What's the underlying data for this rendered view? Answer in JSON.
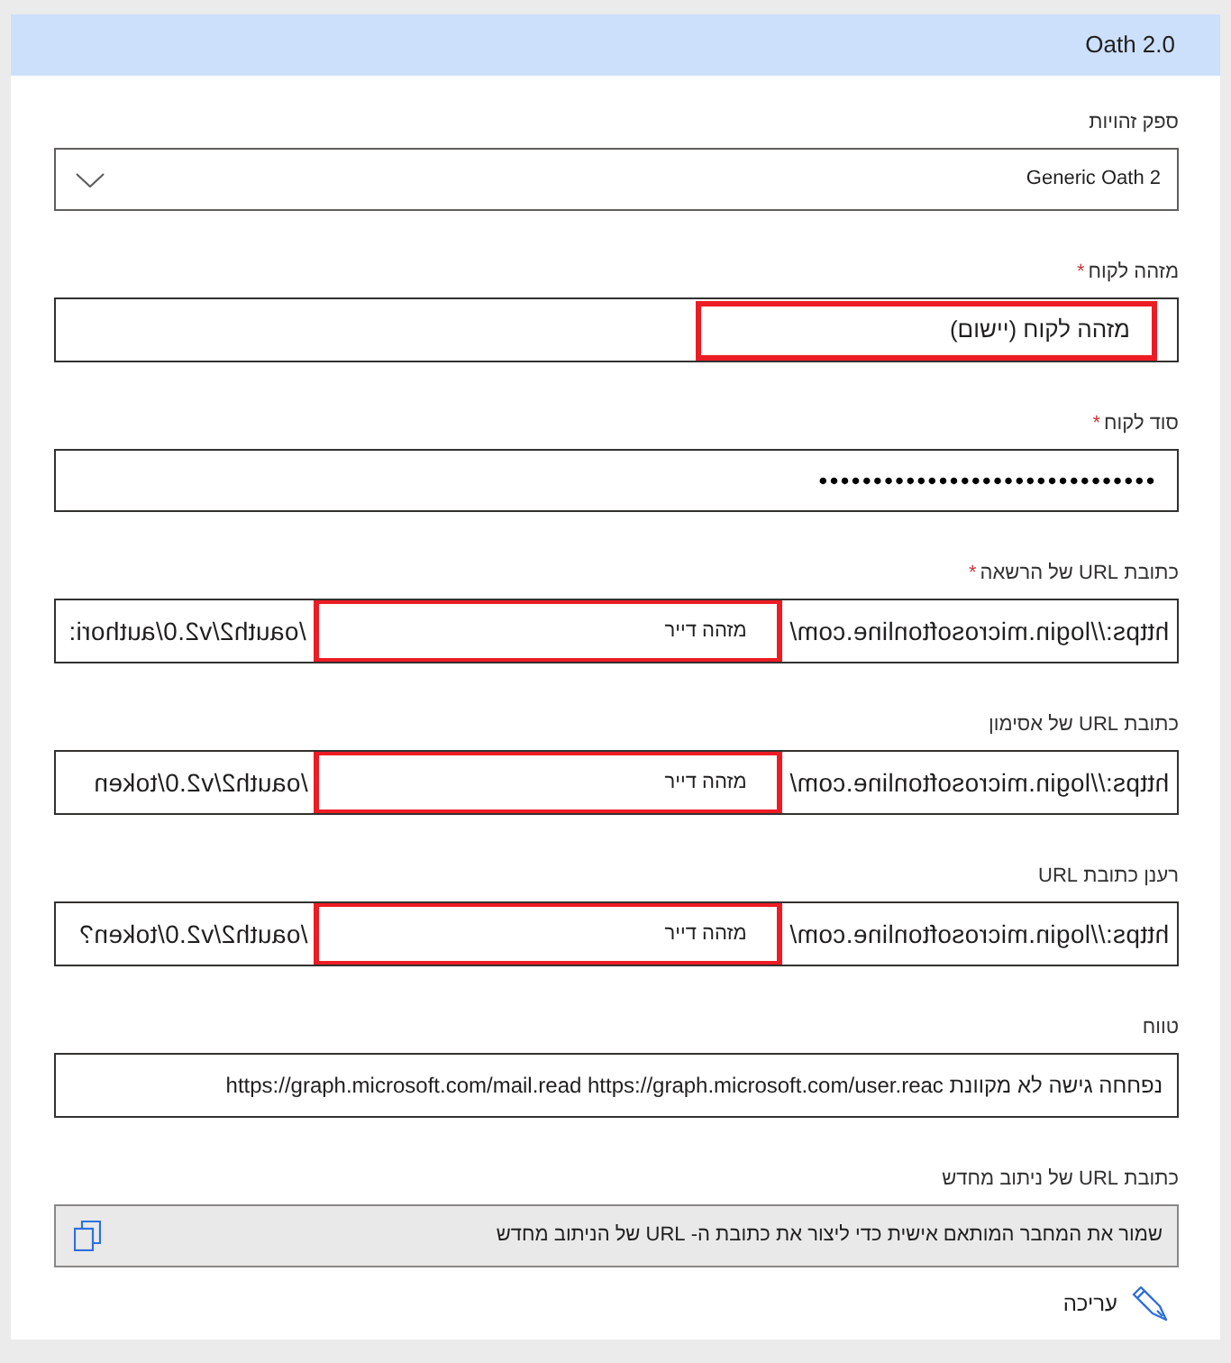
{
  "header": {
    "title": "Oath 2.0"
  },
  "fields": [
    {
      "kind": "dropdown",
      "label": "ספק זהויות",
      "value": "Generic Oath 2"
    },
    {
      "kind": "text",
      "label": "מזהה לקוח",
      "required_mark": "*",
      "segments": [
        {
          "kind": "highlight",
          "text": "מזהה לקוח (יישום)"
        }
      ]
    },
    {
      "kind": "password",
      "label": "סוד לקוח",
      "required_mark": "*",
      "value": "•••••••••••••••••••••••••••••••"
    },
    {
      "kind": "text",
      "label": "כתובת URL של הרשאה",
      "required_mark": "*",
      "segments": [
        {
          "kind": "mirrored",
          "text": "https://login.microsoftonline.com/"
        },
        {
          "kind": "highlight",
          "text": "מזהה דייר"
        },
        {
          "kind": "mirrored",
          "text": "/oauth2/v2.0/authori:"
        }
      ]
    },
    {
      "kind": "text",
      "label": "כתובת URL של אסימון",
      "segments": [
        {
          "kind": "mirrored",
          "text": "https://login.microsoftonline.com/"
        },
        {
          "kind": "highlight",
          "text": "מזהה דייר"
        },
        {
          "kind": "mirrored",
          "text": "/oauth2/v2.0/token"
        }
      ]
    },
    {
      "kind": "text",
      "label": "רענן כתובת URL",
      "segments": [
        {
          "kind": "mirrored",
          "text": "https://login.microsoftonline.com/"
        },
        {
          "kind": "highlight",
          "text": "מזהה דייר"
        },
        {
          "kind": "mirrored",
          "text": "/oauth2/v2.0/token?"
        }
      ]
    },
    {
      "kind": "text",
      "label": "טווח",
      "segments": [
        {
          "kind": "plain",
          "text": "נפחחה גישה לא מקוונת https://graph.microsoft.com/mail.read https://graph.microsoft.com/user.reac"
        }
      ]
    },
    {
      "kind": "readonly",
      "label": "כתובת URL של ניתוב מחדש",
      "value": "שמור את המחבר המותאם אישית כדי ליצור את כתובת ה- URL של הניתוב מחדש"
    }
  ],
  "edit_link": {
    "label": "עריכה"
  }
}
